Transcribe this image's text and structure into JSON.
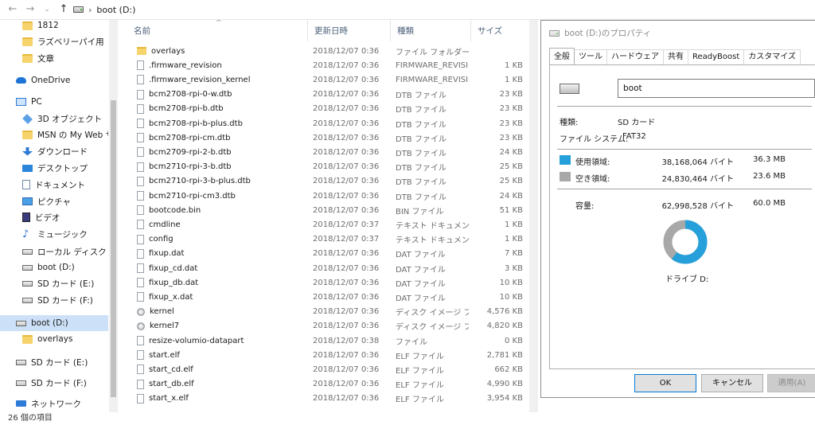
{
  "address": {
    "breadcrumb": [
      "boot (D:)"
    ]
  },
  "sidebar": {
    "items": [
      {
        "label": "1812",
        "icon": "folder-icon"
      },
      {
        "label": "ラズベリーパイ用",
        "icon": "folder-icon"
      },
      {
        "label": "文章",
        "icon": "folder-icon"
      },
      {
        "label": "OneDrive",
        "icon": "onedrive-icon"
      },
      {
        "label": "PC",
        "icon": "pc-icon"
      },
      {
        "label": "3D オブジェクト",
        "icon": "3d-objects-icon"
      },
      {
        "label": "MSN の My Web サイ",
        "icon": "folder-icon"
      },
      {
        "label": "ダウンロード",
        "icon": "download-icon"
      },
      {
        "label": "デスクトップ",
        "icon": "desktop-icon"
      },
      {
        "label": "ドキュメント",
        "icon": "document-icon"
      },
      {
        "label": "ピクチャ",
        "icon": "pictures-icon"
      },
      {
        "label": "ビデオ",
        "icon": "video-icon"
      },
      {
        "label": "ミュージック",
        "icon": "music-icon"
      },
      {
        "label": "ローカル ディスク (C:)",
        "icon": "drive-icon"
      },
      {
        "label": "boot (D:)",
        "icon": "drive-icon"
      },
      {
        "label": "SD カード (E:)",
        "icon": "drive-icon"
      },
      {
        "label": "SD カード (F:)",
        "icon": "drive-icon"
      },
      {
        "label": "boot (D:)",
        "icon": "drive-icon",
        "selected": true
      },
      {
        "label": "overlays",
        "icon": "folder-icon"
      },
      {
        "label": "SD カード (E:)",
        "icon": "drive-icon"
      },
      {
        "label": "SD カード (F:)",
        "icon": "drive-icon"
      },
      {
        "label": "ネットワーク",
        "icon": "network-icon"
      }
    ]
  },
  "filelist": {
    "columns": {
      "name": "名前",
      "date": "更新日時",
      "type": "種類",
      "size": "サイズ"
    },
    "rows": [
      {
        "name": "overlays",
        "date": "2018/12/07 0:36",
        "type": "ファイル フォルダー",
        "size": "",
        "icon": "folder"
      },
      {
        "name": ".firmware_revision",
        "date": "2018/12/07 0:36",
        "type": "FIRMWARE_REVISI...",
        "size": "1 KB",
        "icon": "file"
      },
      {
        "name": ".firmware_revision_kernel",
        "date": "2018/12/07 0:36",
        "type": "FIRMWARE_REVISI...",
        "size": "1 KB",
        "icon": "file"
      },
      {
        "name": "bcm2708-rpi-0-w.dtb",
        "date": "2018/12/07 0:36",
        "type": "DTB ファイル",
        "size": "23 KB",
        "icon": "file"
      },
      {
        "name": "bcm2708-rpi-b.dtb",
        "date": "2018/12/07 0:36",
        "type": "DTB ファイル",
        "size": "23 KB",
        "icon": "file"
      },
      {
        "name": "bcm2708-rpi-b-plus.dtb",
        "date": "2018/12/07 0:36",
        "type": "DTB ファイル",
        "size": "23 KB",
        "icon": "file"
      },
      {
        "name": "bcm2708-rpi-cm.dtb",
        "date": "2018/12/07 0:36",
        "type": "DTB ファイル",
        "size": "23 KB",
        "icon": "file"
      },
      {
        "name": "bcm2709-rpi-2-b.dtb",
        "date": "2018/12/07 0:36",
        "type": "DTB ファイル",
        "size": "24 KB",
        "icon": "file"
      },
      {
        "name": "bcm2710-rpi-3-b.dtb",
        "date": "2018/12/07 0:36",
        "type": "DTB ファイル",
        "size": "25 KB",
        "icon": "file"
      },
      {
        "name": "bcm2710-rpi-3-b-plus.dtb",
        "date": "2018/12/07 0:36",
        "type": "DTB ファイル",
        "size": "25 KB",
        "icon": "file"
      },
      {
        "name": "bcm2710-rpi-cm3.dtb",
        "date": "2018/12/07 0:36",
        "type": "DTB ファイル",
        "size": "24 KB",
        "icon": "file"
      },
      {
        "name": "bootcode.bin",
        "date": "2018/12/07 0:36",
        "type": "BIN ファイル",
        "size": "51 KB",
        "icon": "file"
      },
      {
        "name": "cmdline",
        "date": "2018/12/07 0:37",
        "type": "テキスト ドキュメント",
        "size": "1 KB",
        "icon": "file"
      },
      {
        "name": "config",
        "date": "2018/12/07 0:37",
        "type": "テキスト ドキュメント",
        "size": "1 KB",
        "icon": "file"
      },
      {
        "name": "fixup.dat",
        "date": "2018/12/07 0:36",
        "type": "DAT ファイル",
        "size": "7 KB",
        "icon": "file"
      },
      {
        "name": "fixup_cd.dat",
        "date": "2018/12/07 0:36",
        "type": "DAT ファイル",
        "size": "3 KB",
        "icon": "file"
      },
      {
        "name": "fixup_db.dat",
        "date": "2018/12/07 0:36",
        "type": "DAT ファイル",
        "size": "10 KB",
        "icon": "file"
      },
      {
        "name": "fixup_x.dat",
        "date": "2018/12/07 0:36",
        "type": "DAT ファイル",
        "size": "10 KB",
        "icon": "file"
      },
      {
        "name": "kernel",
        "date": "2018/12/07 0:36",
        "type": "ディスク イメージ ファ...",
        "size": "4,576 KB",
        "icon": "disk"
      },
      {
        "name": "kernel7",
        "date": "2018/12/07 0:36",
        "type": "ディスク イメージ ファ...",
        "size": "4,820 KB",
        "icon": "disk"
      },
      {
        "name": "resize-volumio-datapart",
        "date": "2018/12/07 0:38",
        "type": "ファイル",
        "size": "0 KB",
        "icon": "file"
      },
      {
        "name": "start.elf",
        "date": "2018/12/07 0:36",
        "type": "ELF ファイル",
        "size": "2,781 KB",
        "icon": "file"
      },
      {
        "name": "start_cd.elf",
        "date": "2018/12/07 0:36",
        "type": "ELF ファイル",
        "size": "662 KB",
        "icon": "file"
      },
      {
        "name": "start_db.elf",
        "date": "2018/12/07 0:36",
        "type": "ELF ファイル",
        "size": "4,990 KB",
        "icon": "file"
      },
      {
        "name": "start_x.elf",
        "date": "2018/12/07 0:36",
        "type": "ELF ファイル",
        "size": "3,954 KB",
        "icon": "file"
      }
    ]
  },
  "status": {
    "item_count": "26 個の項目"
  },
  "dialog": {
    "title": "boot (D:)のプロパティ",
    "tabs": [
      "全般",
      "ツール",
      "ハードウェア",
      "共有",
      "ReadyBoost",
      "カスタマイズ"
    ],
    "active_tab": "全般",
    "volume_name": "boot",
    "type_label": "種類:",
    "type_value": "SD カード",
    "fs_label": "ファイル システム:",
    "fs_value": "FAT32",
    "used_label": "使用領域:",
    "used_bytes": "38,168,064 バイト",
    "used_size": "36.3 MB",
    "free_label": "空き領域:",
    "free_bytes": "24,830,464 バイト",
    "free_size": "23.6 MB",
    "capacity_label": "容量:",
    "capacity_bytes": "62,998,528 バイト",
    "capacity_size": "60.0 MB",
    "drive_label": "ドライブ D:",
    "used_fraction": 0.606,
    "used_color": "#26a0da",
    "free_color": "#a8a8a8",
    "buttons": {
      "ok": "OK",
      "cancel": "キャンセル",
      "apply": "適用(A)"
    }
  }
}
